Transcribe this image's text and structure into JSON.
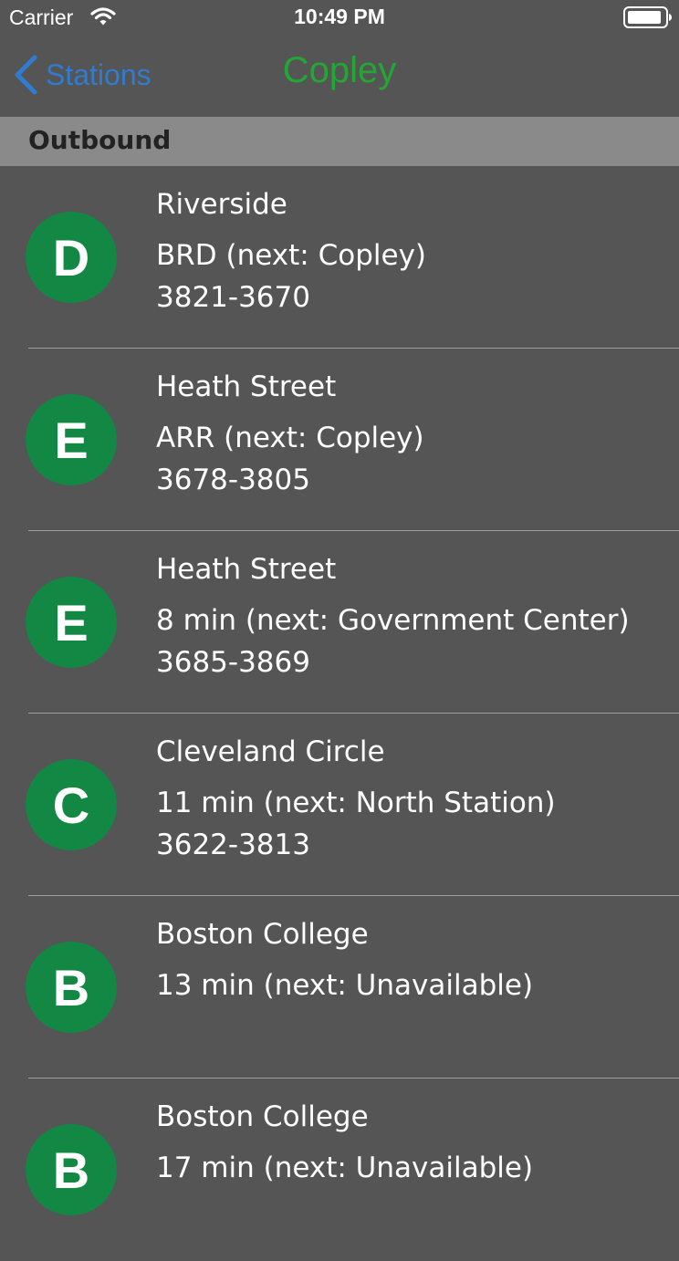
{
  "colors": {
    "background": "#555555",
    "accent_blue": "#2f7cd0",
    "title_green": "#22a832",
    "badge_green": "#128844",
    "section_bg": "#8a8a8a"
  },
  "status_bar": {
    "carrier": "Carrier",
    "time": "10:49 PM"
  },
  "nav": {
    "back_label": "Stations",
    "title": "Copley"
  },
  "section": {
    "title": "Outbound"
  },
  "rows": [
    {
      "line": "D",
      "destination": "Riverside",
      "status": "BRD (next: Copley)",
      "vehicle": "3821-3670"
    },
    {
      "line": "E",
      "destination": "Heath Street",
      "status": "ARR (next: Copley)",
      "vehicle": "3678-3805"
    },
    {
      "line": "E",
      "destination": "Heath Street",
      "status": "8 min (next: Government Center)",
      "vehicle": "3685-3869"
    },
    {
      "line": "C",
      "destination": "Cleveland Circle",
      "status": "11 min (next: North Station)",
      "vehicle": "3622-3813"
    },
    {
      "line": "B",
      "destination": "Boston College",
      "status": "13 min (next: Unavailable)",
      "vehicle": ""
    },
    {
      "line": "B",
      "destination": "Boston College",
      "status": "17 min (next: Unavailable)",
      "vehicle": ""
    }
  ]
}
